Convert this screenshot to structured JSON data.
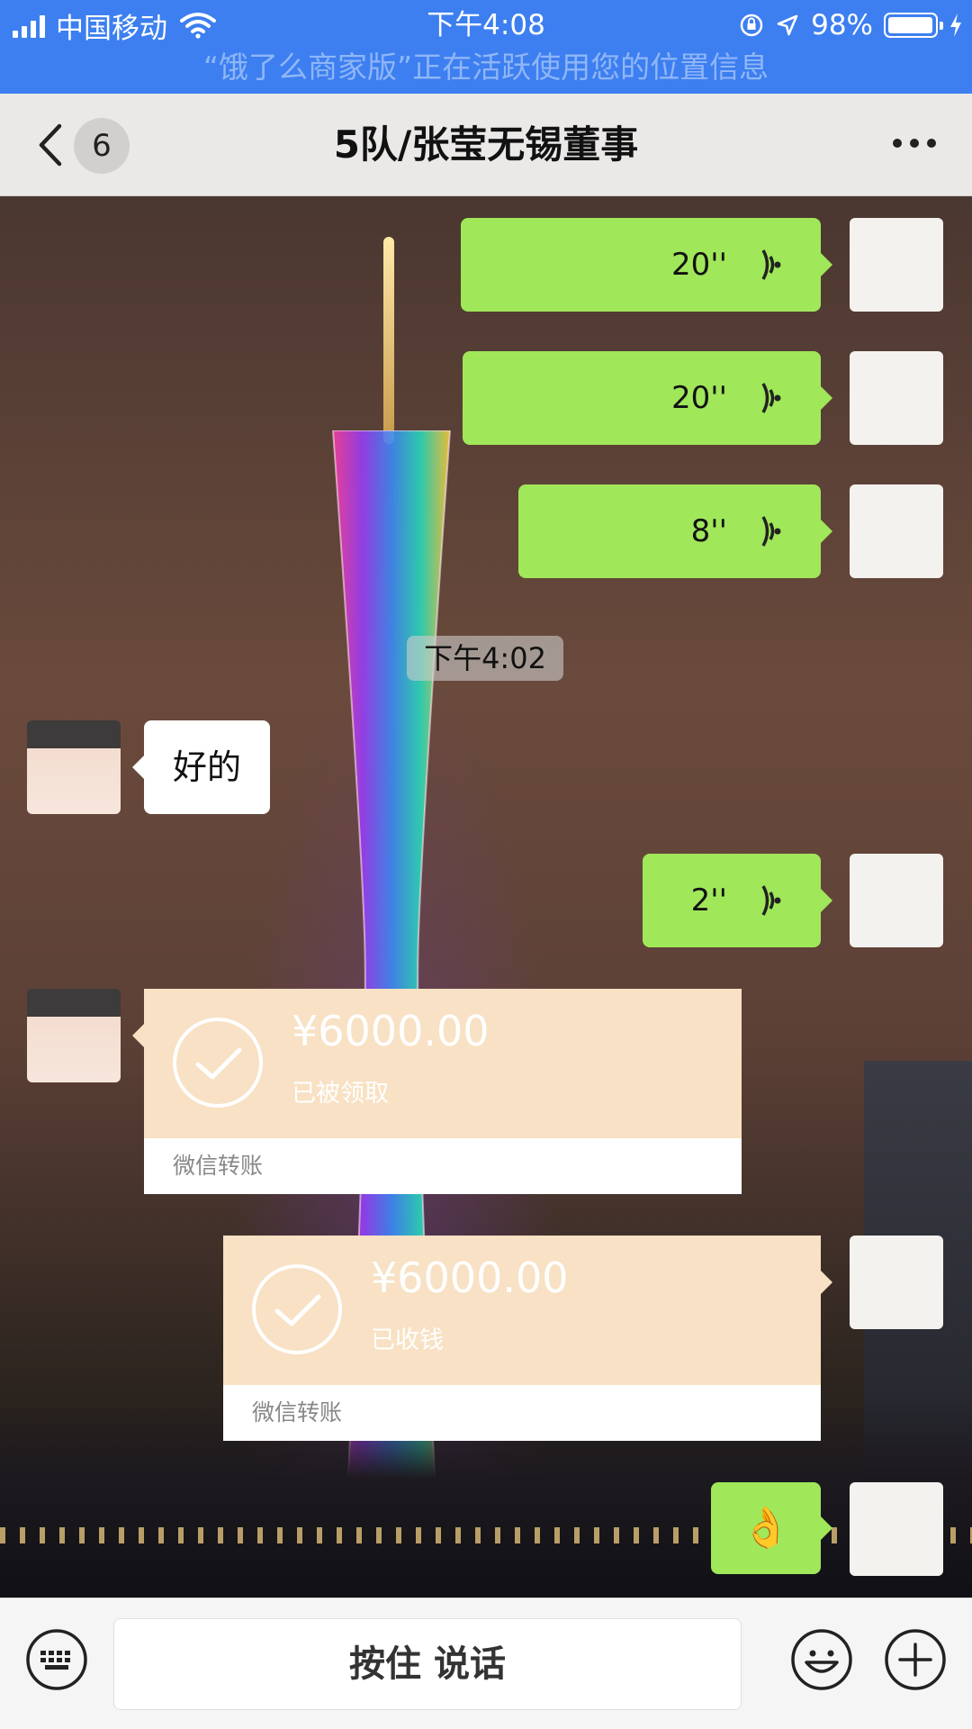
{
  "status_bar": {
    "carrier": "中国移动",
    "time": "下午4:08",
    "battery": "98%",
    "battery_level": 0.98,
    "location_banner": "“饿了么商家版”正在活跃使用您的位置信息"
  },
  "nav": {
    "unread_count": "6",
    "title": "5队/张莹无锡董事"
  },
  "messages": {
    "voice_1": "20''",
    "voice_2": "20''",
    "voice_3": "8''",
    "time_divider": "下午4:02",
    "text_reply": "好的",
    "voice_4": "2''",
    "transfer_1": {
      "amount": "¥6000.00",
      "status": "已被领取",
      "label": "微信转账"
    },
    "transfer_2": {
      "amount": "¥6000.00",
      "status": "已收钱",
      "label": "微信转账"
    },
    "emoji": "👌"
  },
  "input": {
    "hold_to_talk": "按住 说话"
  },
  "colors": {
    "status_bar": "#3d7ff0",
    "sent_bubble": "#a0e75a",
    "transfer_card": "#f8e1c4"
  }
}
